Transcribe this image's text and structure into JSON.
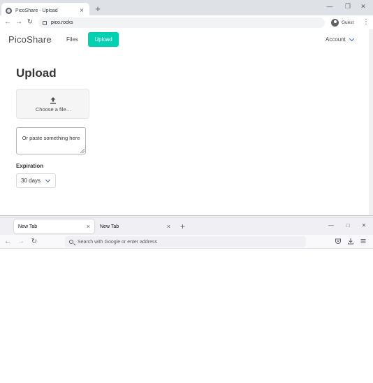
{
  "chrome": {
    "tab_title": "PicoShare - Upload",
    "tab_close": "×",
    "new_tab": "+",
    "url": "pico.rocks",
    "profile_label": "Guest",
    "win_min": "—",
    "win_max": "❐",
    "win_close": "✕",
    "back": "←",
    "forward": "→",
    "reload": "↻",
    "menu": "⋮"
  },
  "page": {
    "brand": "PicoShare",
    "nav_files": "Files",
    "nav_upload": "Upload",
    "account": "Account",
    "heading": "Upload",
    "file_label": "Choose a file…",
    "paste_placeholder": "Or paste something here",
    "expiration_label": "Expiration",
    "expiration_value": "30 days"
  },
  "firefox": {
    "tabs": [
      {
        "label": "New Tab",
        "close": "×"
      },
      {
        "label": "New Tab",
        "close": "×"
      }
    ],
    "new_tab": "+",
    "url_placeholder": "Search with Google or enter address",
    "win_min": "—",
    "win_max": "□",
    "win_close": "✕",
    "back": "←",
    "forward": "→",
    "reload": "↻"
  },
  "colors": {
    "accent": "#00d1b2",
    "link": "#485fc7"
  }
}
